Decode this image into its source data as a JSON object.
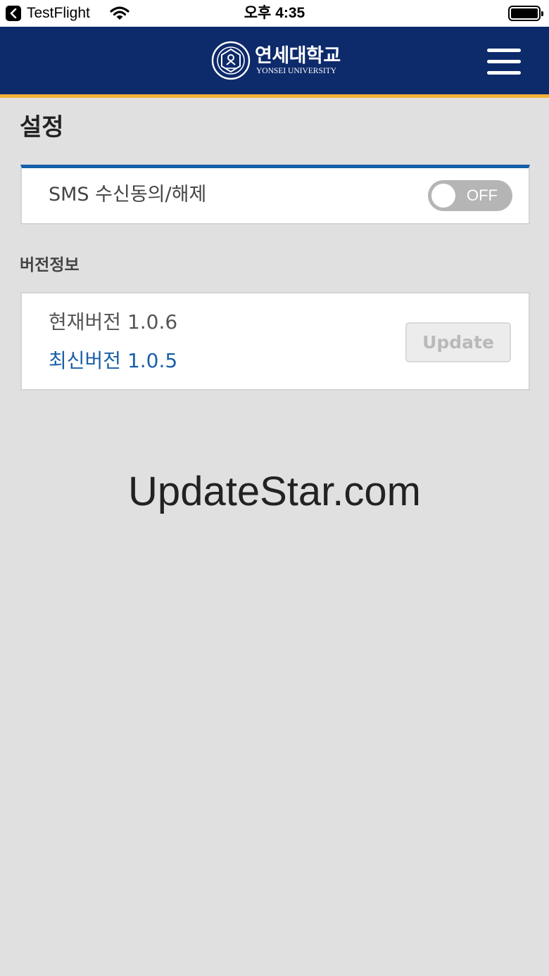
{
  "status_bar": {
    "app_name": "TestFlight",
    "time": "오후 4:35"
  },
  "header": {
    "logo_name_ko": "연세대학교",
    "logo_name_en": "YONSEI UNIVERSITY",
    "icons": {
      "logo": "yonsei-emblem-icon",
      "menu": "hamburger-menu-icon"
    },
    "colors": {
      "background": "#0d2a6b",
      "accent": "#f2b134"
    }
  },
  "page": {
    "title": "설정"
  },
  "sms": {
    "label": "SMS 수신동의/해제",
    "toggle_text": "OFF",
    "enabled": false,
    "accent_color": "#1460a8"
  },
  "version": {
    "section_label": "버전정보",
    "current": "현재버전 1.0.6",
    "latest": "최신버전 1.0.5",
    "update_label": "Update",
    "update_enabled": false
  },
  "watermark": "UpdateStar.com"
}
